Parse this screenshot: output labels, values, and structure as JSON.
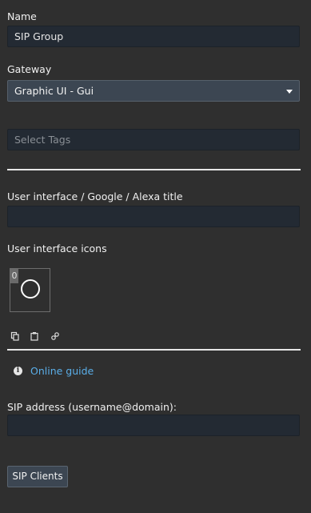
{
  "form": {
    "name_label": "Name",
    "name_value": "SIP Group",
    "gateway_label": "Gateway",
    "gateway_value": "Graphic UI - Gui",
    "tags_placeholder": "Select Tags",
    "ui_title_label": "User interface / Google / Alexa title",
    "ui_title_value": "",
    "ui_icons_label": "User interface icons",
    "icon_index": "0",
    "icons": {
      "copy": "copy-icon",
      "paste": "clipboard-icon",
      "link": "link-icon",
      "info": "info-icon",
      "item": "circle-icon"
    },
    "online_guide_label": "Online guide",
    "sip_address_label": "SIP address (username@domain):",
    "sip_address_value": "",
    "sip_clients_button": "SIP Clients"
  },
  "colors": {
    "background": "#2f2f2f",
    "field": "#232a33",
    "select": "#3c4652",
    "link": "#5aaee8",
    "divider": "#e6e6e6"
  }
}
